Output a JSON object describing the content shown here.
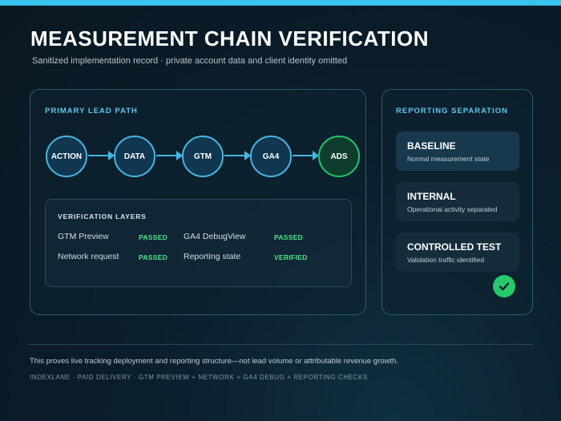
{
  "page": {
    "title": "MEASUREMENT CHAIN VERIFICATION",
    "subtitle": "Sanitized implementation record · private account data and client identity omitted",
    "accent_color": "#37c4f1"
  },
  "primary_path": {
    "heading": "PRIMARY LEAD PATH",
    "nodes": [
      "ACTION",
      "DATA",
      "GTM",
      "GA4",
      "ADS"
    ],
    "node_color": "#47b6e4",
    "final_node_color": "#22c36a"
  },
  "verification": {
    "heading": "VERIFICATION LAYERS",
    "rows": [
      {
        "label": "GTM Preview",
        "status": "PASSED"
      },
      {
        "label": "Network request",
        "status": "PASSED"
      },
      {
        "label": "GA4 DebugView",
        "status": "PASSED"
      },
      {
        "label": "Reporting state",
        "status": "VERIFIED"
      }
    ],
    "status_color": "#4de58a"
  },
  "reporting": {
    "heading": "REPORTING SEPARATION",
    "cards": [
      {
        "title": "BASELINE",
        "subtitle": "Normal measurement state"
      },
      {
        "title": "INTERNAL",
        "subtitle": "Operational activity separated"
      },
      {
        "title": "CONTROLLED TEST",
        "subtitle": "Validation traffic identified"
      }
    ],
    "check_icon": "check-circle-icon"
  },
  "footer": {
    "note": "This proves live tracking deployment and reporting structure—not lead volume or attributable revenue growth.",
    "meta": "INDEXLANE · PAID DELIVERY · GTM PREVIEW + NETWORK + GA4 DEBUG + REPORTING CHECKS"
  }
}
